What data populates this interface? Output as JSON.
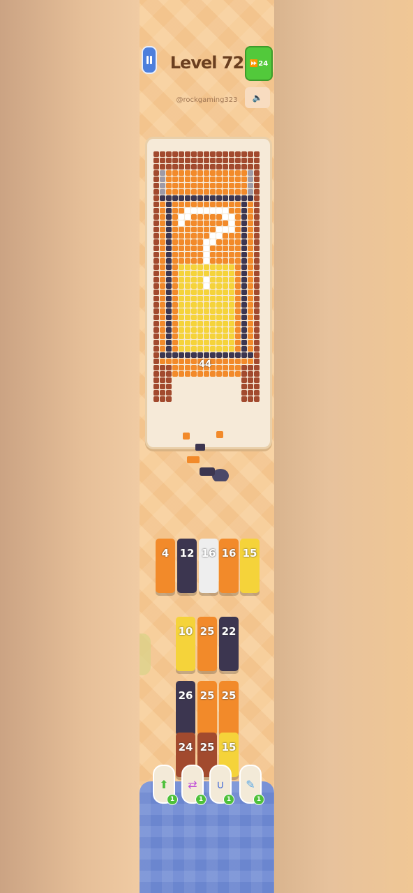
{
  "header": {
    "level_title": "Level 72",
    "username": "@rockgaming323",
    "skip_count": "24"
  },
  "board": {
    "counter_label": "44"
  },
  "queue_slots": [
    {
      "value": "4",
      "color": "#f28a2a"
    },
    {
      "value": "12",
      "color": "#3c3650"
    },
    {
      "value": "16",
      "color": "#eeeeee"
    },
    {
      "value": "16",
      "color": "#f28a2a"
    },
    {
      "value": "15",
      "color": "#f5d33a"
    }
  ],
  "stack_grid": [
    {
      "value": "10",
      "color": "#f5d33a"
    },
    {
      "value": "25",
      "color": "#f28a2a"
    },
    {
      "value": "22",
      "color": "#3c3650"
    },
    {
      "value": "26",
      "color": "#3c3650"
    },
    {
      "value": "25",
      "color": "#f28a2a"
    },
    {
      "value": "25",
      "color": "#f28a2a"
    },
    {
      "value": "24",
      "color": "#a24a2e"
    },
    {
      "value": "25",
      "color": "#a24a2e"
    },
    {
      "value": "15",
      "color": "#f5d33a"
    }
  ],
  "boosters": [
    {
      "icon": "magnet-arrow-icon",
      "count": "1"
    },
    {
      "icon": "shuffle-icon",
      "count": "1"
    },
    {
      "icon": "magnet-icon",
      "count": "1"
    },
    {
      "icon": "brush-icon",
      "count": "1"
    }
  ],
  "colors": {
    "brick": "#a24a2e",
    "orange": "#f28a2a",
    "yellow": "#f5d33a",
    "dark": "#3c3650",
    "white": "#eeeeee",
    "grey": "#9e9aa6"
  }
}
